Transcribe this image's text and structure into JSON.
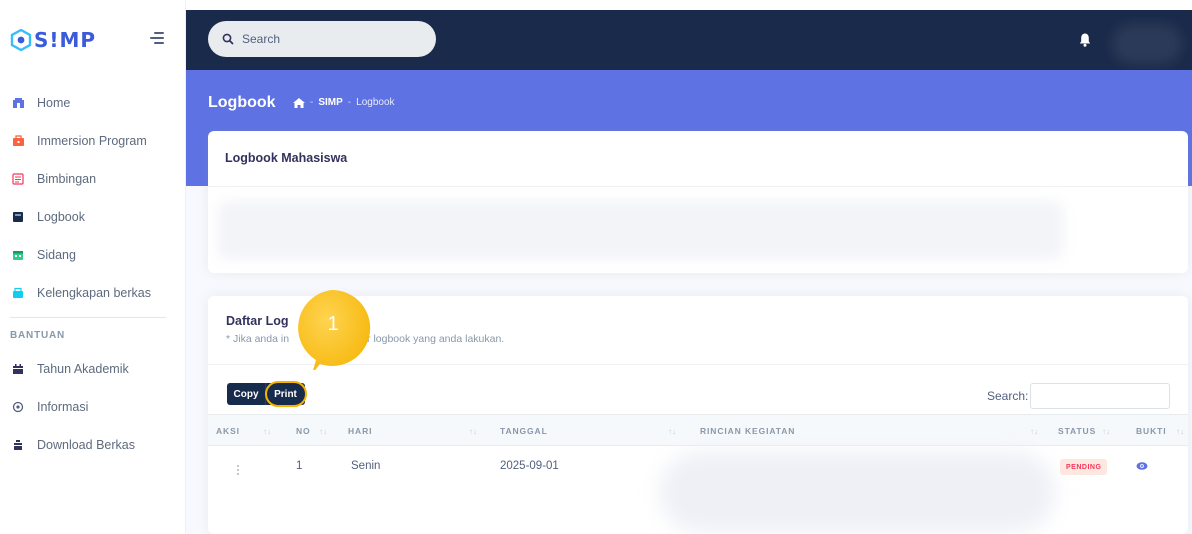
{
  "brand": {
    "name": "S!MP"
  },
  "topbar": {
    "search_placeholder": "Search"
  },
  "sidebar": {
    "items": [
      {
        "label": "Home",
        "icon": "home-icon",
        "color": "#5e72e4"
      },
      {
        "label": "Immersion Program",
        "icon": "briefcase-icon",
        "color": "#fb6340"
      },
      {
        "label": "Bimbingan",
        "icon": "book-icon",
        "color": "#f5365c"
      },
      {
        "label": "Logbook",
        "icon": "notebook-icon",
        "color": "#172b4d"
      },
      {
        "label": "Sidang",
        "icon": "calendar-icon",
        "color": "#2dce89"
      },
      {
        "label": "Kelengkapan berkas",
        "icon": "folder-icon",
        "color": "#11cdef"
      }
    ],
    "section_heading": "BANTUAN",
    "help_items": [
      {
        "label": "Tahun Akademik",
        "icon": "calendar-icon"
      },
      {
        "label": "Informasi",
        "icon": "info-icon"
      },
      {
        "label": "Download Berkas",
        "icon": "download-icon"
      }
    ]
  },
  "header": {
    "title": "Logbook",
    "breadcrumb": [
      "SIMP",
      "Logbook"
    ]
  },
  "card1": {
    "title": "Logbook Mahasiswa"
  },
  "card2": {
    "title": "Daftar Log",
    "note_start": "* Jika anda in",
    "note_end": "r logbook yang anda lakukan.",
    "buttons": {
      "copy": "Copy",
      "print": "Print"
    },
    "search_label": "Search:",
    "columns": [
      "AKSI",
      "NO",
      "HARI",
      "TANGGAL",
      "RINCIAN KEGIATAN",
      "STATUS",
      "BUKTI"
    ],
    "rows": [
      {
        "no": "1",
        "hari": "Senin",
        "tanggal": "2025-09-01",
        "status": "PENDING"
      }
    ]
  },
  "callout": {
    "number": "1",
    "color": "#f5b400"
  }
}
